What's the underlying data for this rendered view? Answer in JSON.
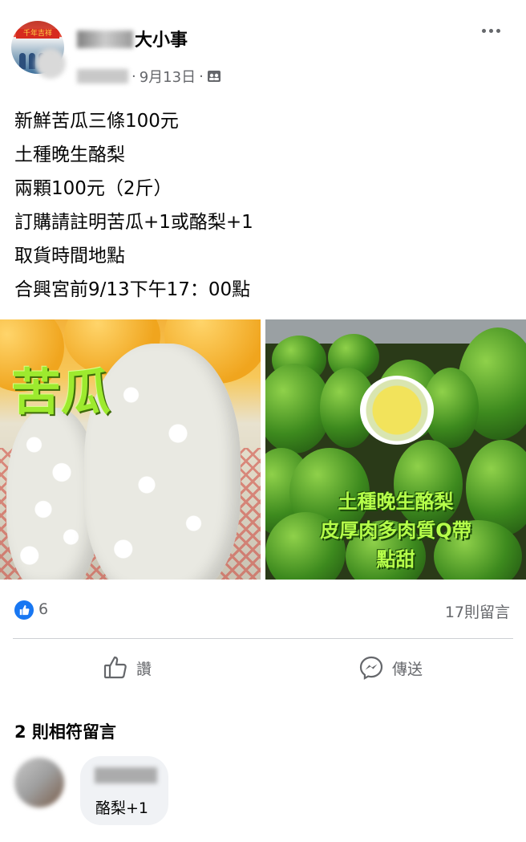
{
  "header": {
    "page_name": "大小事",
    "date": "9月13日",
    "separator": "·",
    "separator2": "·",
    "more_icon": "more-horizontal-icon",
    "visibility_icon": "group-icon"
  },
  "post": {
    "lines": [
      "新鮮苦瓜三條100元",
      "土種晚生酪梨",
      "兩顆100元（2斤）",
      "訂購請註明苦瓜+1或酪梨+1",
      "取貨時間地點",
      "合興宮前9/13下午17：00點"
    ],
    "photo_left_label": "苦瓜",
    "photo_right_lines": [
      "土種晚生酪梨",
      "皮厚肉多肉質Q帶",
      "點甜"
    ]
  },
  "reactions": {
    "like_count": "6",
    "comment_count": "17則留言"
  },
  "actions": {
    "like_label": "讚",
    "share_label": "傳送"
  },
  "comments": {
    "matched_header": "2 則相符留言",
    "items": [
      {
        "text": "酪梨+1"
      }
    ]
  },
  "colors": {
    "accent": "#1877f2",
    "secondary_text": "#65676b"
  }
}
